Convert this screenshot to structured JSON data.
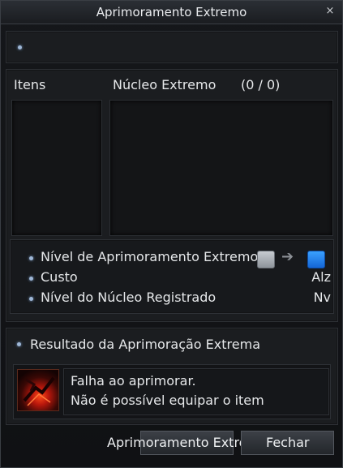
{
  "window": {
    "title": "Aprimoramento Extremo",
    "close_glyph": "×"
  },
  "columns": {
    "items_label": "Itens",
    "core_label": "Núcleo Extremo",
    "core_count": "(0 / 0)"
  },
  "info": {
    "level_label": "Nível de Aprimoramento Extremo",
    "cost_label": "Custo",
    "cost_value": "Alz",
    "core_level_label": "Nível do Núcleo Registrado",
    "core_level_value": "Nv",
    "arrow_glyph": "➔"
  },
  "result": {
    "header": "Resultado da Aprimoração Extrema",
    "line1": "Falha ao aprimorar.",
    "line2": "Não é possível equipar o item",
    "icon": "failure-icon"
  },
  "buttons": {
    "enhance": "Aprimoramento Extremo",
    "close": "Fechar"
  },
  "colors": {
    "accent_blue": "#1f7ef0",
    "bullet": "#9fb7d6"
  }
}
